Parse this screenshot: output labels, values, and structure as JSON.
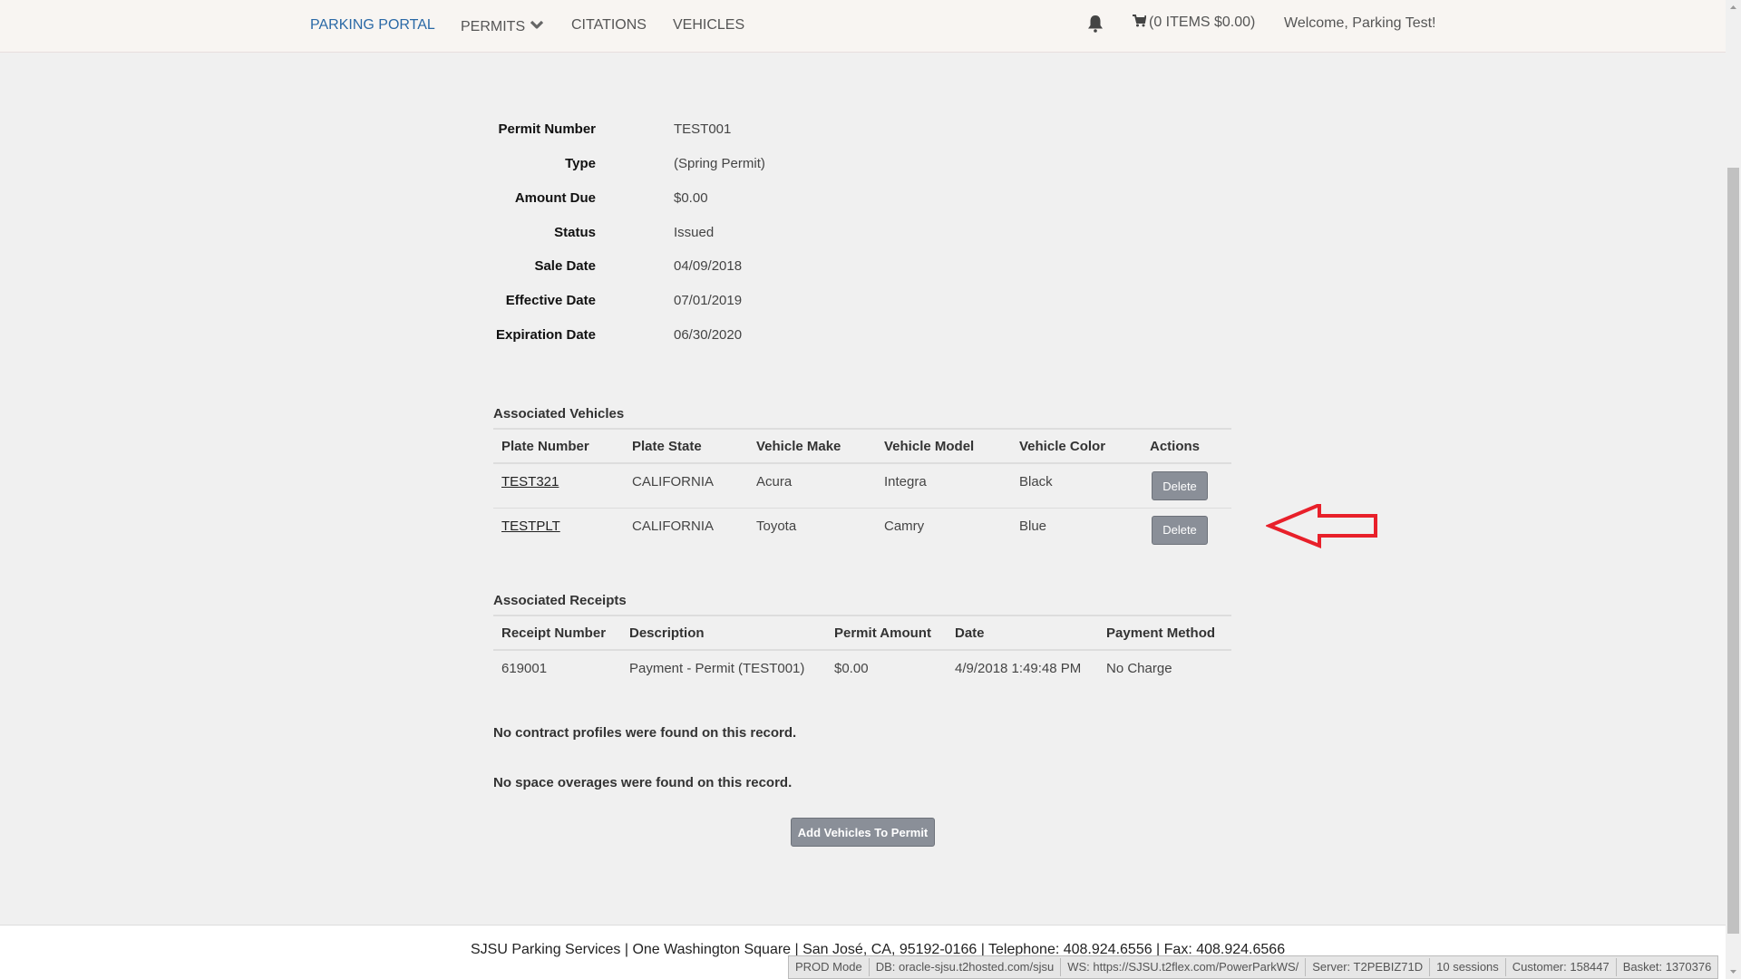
{
  "nav": {
    "brand": "PARKING PORTAL",
    "permits": "PERMITS",
    "citations": "CITATIONS",
    "vehicles": "VEHICLES",
    "cart": "(0 ITEMS $0.00)",
    "welcome": "Welcome, Parking Test!",
    "brand_color": "#2a69a6"
  },
  "permit": {
    "fields": [
      {
        "label": "Permit Number",
        "value": "TEST001"
      },
      {
        "label": "Type",
        "value": "(Spring Permit)"
      },
      {
        "label": "Amount Due",
        "value": "$0.00"
      },
      {
        "label": "Status",
        "value": "Issued"
      },
      {
        "label": "Sale Date",
        "value": "04/09/2018"
      },
      {
        "label": "Effective Date",
        "value": "07/01/2019"
      },
      {
        "label": "Expiration Date",
        "value": "06/30/2020"
      }
    ]
  },
  "vehicles": {
    "title": "Associated Vehicles",
    "headers": [
      "Plate Number",
      "Plate State",
      "Vehicle Make",
      "Vehicle Model",
      "Vehicle Color",
      "Actions"
    ],
    "rows": [
      {
        "plate": "TEST321",
        "state": "CALIFORNIA",
        "make": "Acura",
        "model": "Integra",
        "color": "Black",
        "action": "Delete"
      },
      {
        "plate": "TESTPLT",
        "state": "CALIFORNIA",
        "make": "Toyota",
        "model": "Camry",
        "color": "Blue",
        "action": "Delete"
      }
    ]
  },
  "receipts": {
    "title": "Associated Receipts",
    "headers": [
      "Receipt Number",
      "Description",
      "Permit Amount",
      "Date",
      "Payment Method"
    ],
    "rows": [
      {
        "number": "619001",
        "description": "Payment - Permit (TEST001)",
        "amount": "$0.00",
        "date": "4/9/2018 1:49:48 PM",
        "method": "No Charge"
      }
    ]
  },
  "messages": {
    "contract": "No contract profiles were found on this record.",
    "overages": "No space overages were found on this record."
  },
  "add_vehicles_button": "Add Vehicles To Permit",
  "annotation": {
    "color": "#e8202a"
  },
  "footer": {
    "text": "SJSU Parking Services | One Washington Square | San José, CA, 95192-0166 | Telephone: 408.924.6556 | Fax: 408.924.6566"
  },
  "statusbar": {
    "mode": "PROD Mode",
    "db": "DB: oracle-sjsu.t2hosted.com/sjsu",
    "ws": "WS: https://SJSU.t2flex.com/PowerParkWS/",
    "server": "Server: T2PEBIZ71D",
    "sessions": "10 sessions",
    "customer": "Customer: 158447",
    "basket": "Basket: 1370376"
  }
}
